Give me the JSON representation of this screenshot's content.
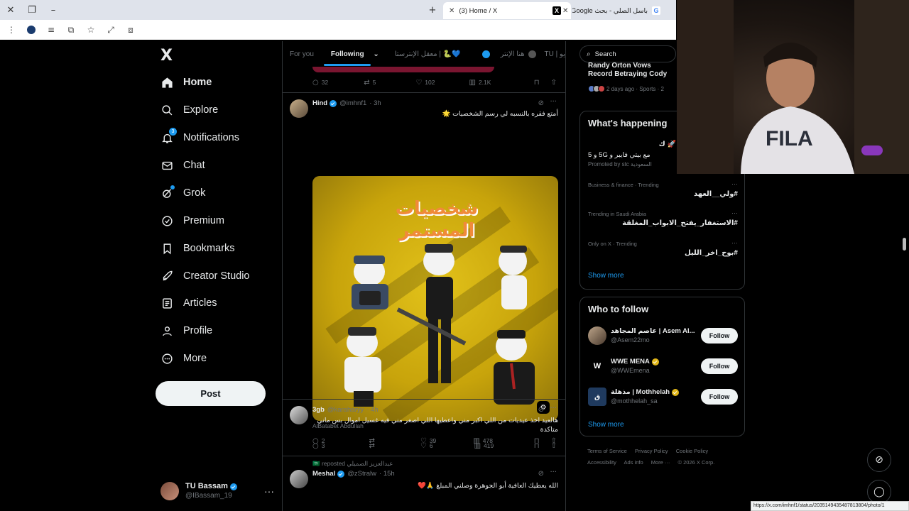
{
  "browser": {
    "tabs": [
      {
        "title": "(3) Home / X",
        "favicon": "X"
      },
      {
        "title": "باسل الصلي - بحث Google",
        "favicon": "G"
      }
    ],
    "new_tab": "+",
    "status_url": "https://x.com/imhnf1/status/2035149435487813804/photo/1"
  },
  "nav": {
    "logo": "X",
    "items": [
      {
        "label": "Home",
        "icon": "home-icon"
      },
      {
        "label": "Explore",
        "icon": "search-icon"
      },
      {
        "label": "Notifications",
        "icon": "bell-icon",
        "badge": "3"
      },
      {
        "label": "Chat",
        "icon": "mail-icon"
      },
      {
        "label": "Grok",
        "icon": "grok-icon"
      },
      {
        "label": "Premium",
        "icon": "verified-icon"
      },
      {
        "label": "Bookmarks",
        "icon": "bookmark-icon"
      },
      {
        "label": "Creator Studio",
        "icon": "rocket-icon"
      },
      {
        "label": "Articles",
        "icon": "article-icon"
      },
      {
        "label": "Profile",
        "icon": "person-icon"
      },
      {
        "label": "More",
        "icon": "more-circle-icon"
      }
    ],
    "post_button": "Post",
    "account": {
      "display_name": "TU Bassam",
      "handle": "@IBassam_19",
      "menu": "···"
    }
  },
  "feed": {
    "tabs": [
      "For you",
      "Following",
      "💙🐍 | معقل الإنترستا",
      "هنا الإنتر",
      "تي يو | TU"
    ],
    "prev_actions": {
      "replies": "32",
      "reposts": "5",
      "likes": "102",
      "views": "2.1K"
    },
    "posts": [
      {
        "name": "Hind",
        "handle": "@imhnf1",
        "time": "· 3h",
        "text": "أمتع فقره بالنسبه لي رسم الشخصيات 🌟",
        "image_title": "شخصيات المستمر",
        "caption": "AlBatabet Abdullah",
        "replies": "2",
        "reposts": "",
        "likes": "39",
        "views": "478"
      },
      {
        "name": "3gb",
        "handle": "@karaharyy",
        "time": "· 4h",
        "text": "هالعيد اخذ عيديات من اللي اكبر مني واعطيها اللي اصغر مني فيه  غسيل اموال بس ماني متاكدة",
        "replies": "3",
        "reposts": "",
        "likes": "6",
        "views": "419"
      },
      {
        "repost_by": "عبدالعزيز الصميلي 🇸🇦 reposted",
        "name": "Meshal",
        "handle": "@zStralw",
        "time": "· 15h",
        "text": "الله يعطيك العافية أبو الجوهرة وصلني المبلغ 🙏❤️"
      }
    ]
  },
  "sidebar": {
    "search_placeholder": "Search",
    "news_title": "Randy Orton Vows Record Betraying Cody Rhodes or",
    "news_meta": "2 days ago · Sports · 2",
    "whats_happening": {
      "title": "What's happening",
      "promo_text": "🚀 ك",
      "promo_line": "مع بيتي فايبر و 5G و 5",
      "promoted_by": "Promoted by stc السعودية",
      "trends": [
        {
          "context": "Business & finance · Trending",
          "title": "#ولي__العهد"
        },
        {
          "context": "Trending in Saudi Arabia",
          "title": "#الاستغفار_يفتح_الابواب_المغلقة"
        },
        {
          "context": "Only on X · Trending",
          "title": "#بوح_اخر_الليل"
        }
      ],
      "show_more": "Show more"
    },
    "who_to_follow": {
      "title": "Who to follow",
      "accounts": [
        {
          "name": "عاصم المجاهد | Asem Al...",
          "handle": "@Asem22mo",
          "verified": "none"
        },
        {
          "name": "WWE MENA",
          "handle": "@WWEmena",
          "verified": "gold"
        },
        {
          "name": "مذهلة | Mothhelah",
          "handle": "@mothhelah_sa",
          "verified": "gold"
        }
      ],
      "follow_label": "Follow",
      "show_more": "Show more"
    },
    "footer": [
      "Terms of Service",
      "Privacy Policy",
      "Cookie Policy",
      "Accessibility",
      "Ads info",
      "More ···",
      "© 2026 X Corp."
    ]
  },
  "colors": {
    "accent": "#1d9bf0",
    "background": "#000000",
    "text": "#e7e9ea",
    "muted": "#71767b",
    "border": "#2f3336"
  }
}
